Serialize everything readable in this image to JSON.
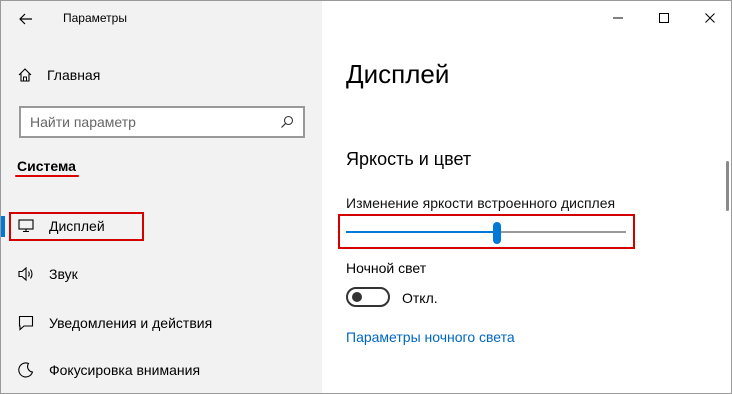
{
  "window": {
    "title": "Параметры",
    "controls": [
      "minimize-icon",
      "maximize-icon",
      "close-icon"
    ]
  },
  "sidebar": {
    "home_label": "Главная",
    "search": {
      "placeholder": "Найти параметр"
    },
    "section_heading": "Система",
    "items": [
      {
        "label": "Дисплей",
        "icon": "monitor-icon",
        "active": true
      },
      {
        "label": "Звук",
        "icon": "speaker-icon"
      },
      {
        "label": "Уведомления и действия",
        "icon": "notifications-icon"
      },
      {
        "label": "Фокусировка внимания",
        "icon": "focus-assist-icon"
      }
    ]
  },
  "main": {
    "page_title": "Дисплей",
    "group_title": "Яркость и цвет",
    "brightness": {
      "label": "Изменение яркости встроенного дисплея",
      "value_fraction": 0.54
    },
    "night_light": {
      "label": "Ночной свет",
      "state": "Откл.",
      "on": false
    },
    "night_light_settings_link": "Параметры ночного света"
  },
  "colors": {
    "accent": "#0078d7",
    "highlight": "#d40000",
    "link": "#0067c0"
  }
}
